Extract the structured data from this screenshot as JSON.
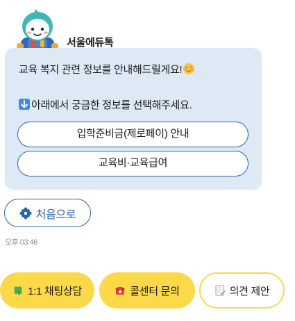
{
  "bot": {
    "name": "서울에듀톡"
  },
  "message": {
    "line1": "교육 복지 관련 정보를 안내해드릴게요!",
    "line2": "아래에서 궁금한 정보를 선택해주세요.",
    "choices": [
      {
        "label": "입학준비금(제로페이) 안내"
      },
      {
        "label": "교육비·교육급여"
      }
    ]
  },
  "home_button": {
    "label": "처음으로"
  },
  "timestamp": "오후 03:46",
  "quick_buttons": [
    {
      "label": "1:1 채팅상담",
      "icon": "clover-icon"
    },
    {
      "label": "콜센터 문의",
      "icon": "telephone-icon"
    },
    {
      "label": "의견 제안",
      "icon": "memo-icon"
    }
  ],
  "colors": {
    "bubble_bg": "#dde9f5",
    "accent_blue": "#2a63a8",
    "quick_yellow": "#fbd949"
  }
}
